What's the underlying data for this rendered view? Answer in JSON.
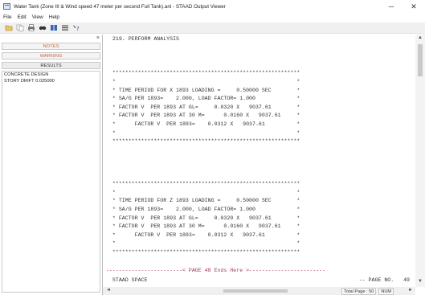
{
  "window": {
    "title": "Water Tank (Zone III & Wind speed 47 meter per second Full Tank).anl - STAAD Output Viewer",
    "minimize": "─",
    "close": "✕"
  },
  "menu": [
    "File",
    "Edit",
    "View",
    "Help"
  ],
  "toolbar": {
    "icons": [
      "open-icon",
      "copy-icon",
      "print-icon",
      "find-icon",
      "page-icon",
      "list-icon",
      "help-icon"
    ]
  },
  "left_panel": {
    "close": "×",
    "tabs": {
      "notes": "NOTES",
      "warning": "WARNING",
      "results": "RESULTS"
    },
    "items": [
      "CONCRETE DESIGN",
      "STORY   DRIFT  0.025000"
    ],
    "tab_color": "#c06a3a"
  },
  "output": {
    "lines": [
      "  219. PERFORM ANALYSIS",
      "",
      "",
      "",
      "  ***********************************************************",
      "  *                                                         *",
      "  * TIME PERIOD FOR X 1893 LOADING =     0.50000 SEC        *",
      "  * SA/G PER 1893=    2.000, LOAD FACTOR= 1.000             *",
      "  * FACTOR V  PER 1893 AT GL=     0.0320 X   9037.61        *",
      "  * FACTOR V  PER 1893 AT 30 M=      0.0160 X   9037.61     *",
      "  *      FACTOR V  PER 1893=    0.0312 X   9037.61          *",
      "  *                                                         *",
      "  ***********************************************************",
      "",
      "",
      "",
      "",
      "  ***********************************************************",
      "  *                                                         *",
      "  * TIME PERIOD FOR Z 1893 LOADING =     0.50000 SEC        *",
      "  * SA/G PER 1893=    2.000, LOAD FACTOR= 1.000             *",
      "  * FACTOR V  PER 1893 AT GL=     0.0320 X   9037.61        *",
      "  * FACTOR V  PER 1893 AT 30 M=      0.0160 X   9037.61     *",
      "  *      FACTOR V  PER 1893=    0.0312 X   9037.61          *",
      "  *                                                         *",
      "  ***********************************************************",
      ""
    ],
    "page_separator": "------------------------< PAGE 48 Ends Here >------------------------",
    "footer_left": "  STAAD SPACE",
    "footer_right": "-- PAGE NO.   49",
    "separator_color": "#a03a5a"
  },
  "statusbar": {
    "total_pages": "Total Page :  50",
    "num": "NUM"
  },
  "scroll": {
    "up": "▲",
    "down": "▼",
    "left": "◄",
    "right": "►"
  }
}
